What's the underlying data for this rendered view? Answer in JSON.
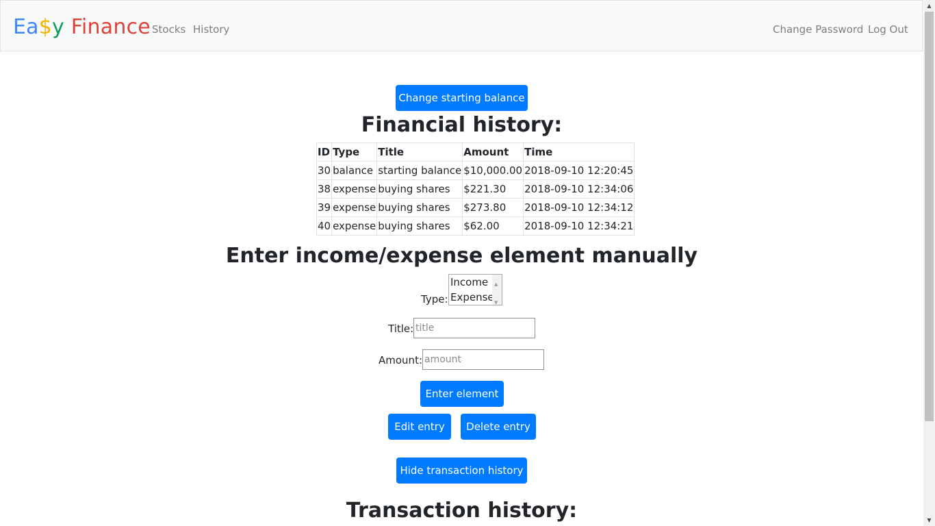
{
  "navbar": {
    "brand": {
      "part1": "Ea",
      "part2": "$",
      "part3": "y",
      "part4": " Finance"
    },
    "links": [
      "Stocks",
      "History"
    ],
    "right_links": [
      "Change Password",
      "Log Out"
    ]
  },
  "colors": {
    "accent": "#007bff",
    "brand_blue": "#4285f4",
    "brand_yellow": "#f4b400",
    "brand_green": "#0f9d58",
    "brand_red": "#db4437"
  },
  "buttons": {
    "change_balance": "Change starting balance",
    "enter_element": "Enter element",
    "edit_entry": "Edit entry",
    "delete_entry": "Delete entry",
    "hide_history": "Hide transaction history"
  },
  "financial_history": {
    "title": "Financial history:",
    "columns": [
      "ID",
      "Type",
      "Title",
      "Amount",
      "Time"
    ],
    "rows": [
      [
        "30",
        "balance",
        "starting balance",
        "$10,000.00",
        "2018-09-10 12:20:45"
      ],
      [
        "38",
        "expense",
        "buying shares",
        "$221.30",
        "2018-09-10 12:34:06"
      ],
      [
        "39",
        "expense",
        "buying shares",
        "$273.80",
        "2018-09-10 12:34:12"
      ],
      [
        "40",
        "expense",
        "buying shares",
        "$62.00",
        "2018-09-10 12:34:21"
      ]
    ]
  },
  "entry_form": {
    "title": "Enter income/expense element manually",
    "type_label": "Type:",
    "type_options": [
      "Income",
      "Expense"
    ],
    "title_label": "Title:",
    "title_placeholder": "title",
    "amount_label": "Amount:",
    "amount_placeholder": "amount"
  },
  "transaction_history": {
    "title": "Transaction history:"
  }
}
